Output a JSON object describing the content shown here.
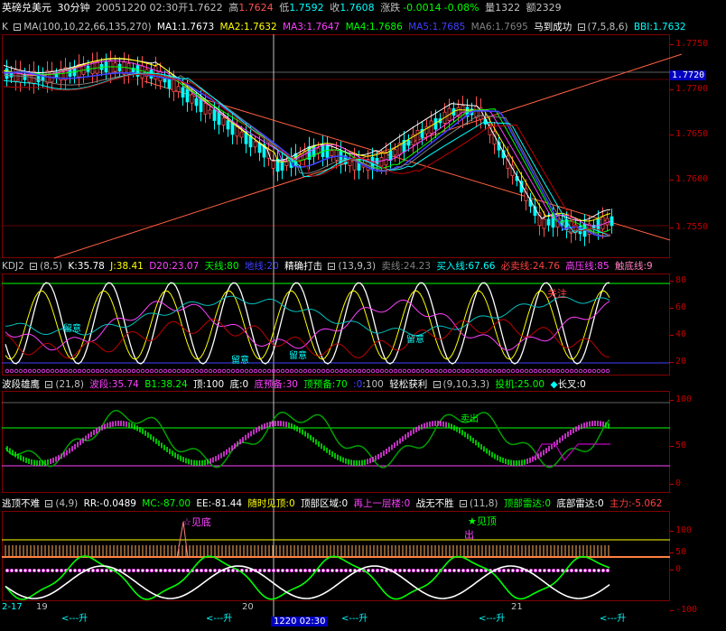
{
  "header": {
    "title": "英磅兑美元",
    "period": "30分钟",
    "datetime": "20051220 02:30",
    "open_label": "开",
    "open": "1.7622",
    "high_label": "高",
    "high": "1.7624",
    "low_label": "低",
    "low": "1.7592",
    "close_label": "收",
    "close": "1.7608",
    "change_label": "涨跌",
    "change": "-0.0014",
    "change_pct": "-0.08%",
    "volume_label": "量",
    "volume": "1322",
    "amount_label": "额",
    "amount": "2329"
  },
  "pane1": {
    "name": "K",
    "ma_name": "MA",
    "params": "(100,10,22,66,135,270)",
    "ma1": "MA1:1.7673",
    "ma2": "MA2:1.7632",
    "ma3": "MA3:1.7647",
    "ma4": "MA4:1.7686",
    "ma5": "MA5:1.7685",
    "ma6": "MA6:1.7695",
    "ind2": "马到成功",
    "ind2_params": "(7,5,8,6)",
    "bbi": "BBI:1.7632",
    "axis": [
      "1.7750",
      "1.7720",
      "1.7700",
      "1.7650",
      "1.7600",
      "1.7550"
    ],
    "current": "1.7720"
  },
  "pane2": {
    "name": "KDJ2",
    "params": "(8,5)",
    "k": "K:35.78",
    "j": "J:38.41",
    "d20": "D20:23.07",
    "tian": "天线:80",
    "di": "地线:20",
    "ind2": "精确打击",
    "ind2_params": "(13,9,3)",
    "sell": "卖线:24.23",
    "buy": "买入线:67.66",
    "mustsell": "必卖线:24.76",
    "press": "高压线:85",
    "bottom": "触底线:9",
    "axis": [
      "80",
      "60",
      "40",
      "20"
    ],
    "ann_guanzhu": "关注",
    "ann_liuyi1": "留意",
    "ann_liuyi2": "留意",
    "ann_liuyi3": "留意",
    "ann_liuyi4": "留意"
  },
  "pane3": {
    "name": "波段雄鹰",
    "params": "(21,8)",
    "bd": "波段:35.74",
    "b1": "B1:38.24",
    "top": "顶:100",
    "bottom": "底:0",
    "dyb": "底预备:30",
    "dyb2": "顶预备:70",
    "zero": ":0",
    "hundred": ":100",
    "ind2": "轻松获利",
    "ind2_params": "(9,10,3,3)",
    "tj": "投机:25.00",
    "cx": "长叉:0",
    "axis": [
      "100",
      "50",
      "0"
    ],
    "ann_chuchu": "卖出"
  },
  "pane4": {
    "name": "逃顶不难",
    "params": "(4,9)",
    "rr": "RR:-0.0489",
    "mc": "MC:-87.00",
    "ee": "EE:-81.44",
    "sj": "随时见顶:0",
    "dbqy": "顶部区域:0",
    "zsyc": "再上一层楼:0",
    "zwbs": "战无不胜",
    "ind2_params": "(11,8)",
    "dbld": "顶部雷达:0",
    "dbld2": "底部雷达:0",
    "zl": "主力:-5.062",
    "axis": [
      "100",
      "50",
      "0",
      "-100"
    ],
    "ann_jiandi": "☆见底",
    "ann_jianding": "★见顶",
    "ann_chu": "出"
  },
  "xaxis": {
    "l0": "2-17",
    "l1": "19",
    "l2": "20",
    "l3": "21",
    "cursor": "1220 02:30",
    "up1": "<---升",
    "up2": "<---升",
    "up3": "<---升",
    "up4": "<---升",
    "up5": "<---升"
  },
  "colors": {
    "up": "#ff5050",
    "down": "#00ffff",
    "grid": "#800000",
    "ma_white": "#ffffff",
    "ma_yellow": "#ffff00",
    "ma_magenta": "#ff40ff",
    "ma_green": "#00ff00",
    "ma_blue": "#4040ff"
  }
}
